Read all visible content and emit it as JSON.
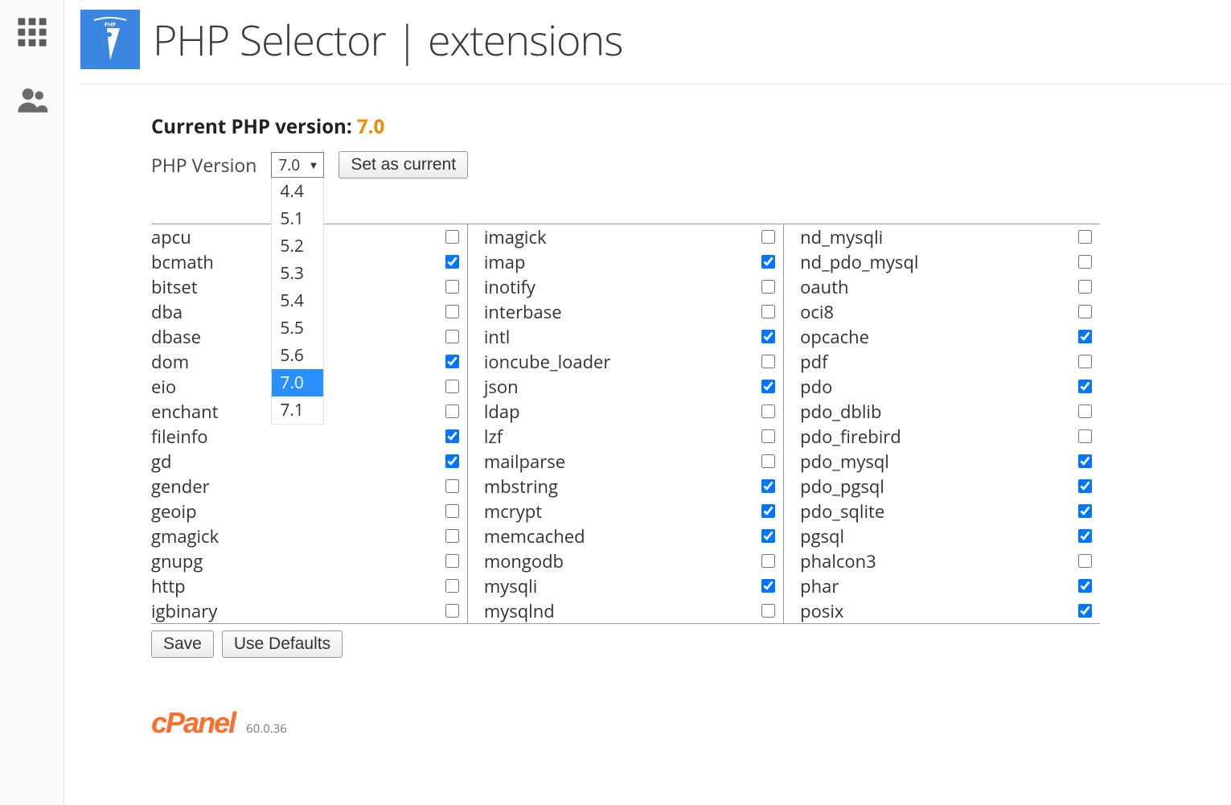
{
  "page_title": "PHP Selector | extensions",
  "current_version_label": "Current PHP version:",
  "current_version_value": "7.0",
  "version_row": {
    "label": "PHP Version",
    "selected": "7.0",
    "set_button": "Set as current",
    "options": [
      "4.4",
      "5.1",
      "5.2",
      "5.3",
      "5.4",
      "5.5",
      "5.6",
      "7.0",
      "7.1"
    ]
  },
  "extensions_columns": [
    [
      {
        "name": "apcu",
        "checked": false
      },
      {
        "name": "bcmath",
        "checked": true
      },
      {
        "name": "bitset",
        "checked": false
      },
      {
        "name": "dba",
        "checked": false
      },
      {
        "name": "dbase",
        "checked": false
      },
      {
        "name": "dom",
        "checked": true
      },
      {
        "name": "eio",
        "checked": false
      },
      {
        "name": "enchant",
        "checked": false
      },
      {
        "name": "fileinfo",
        "checked": true
      },
      {
        "name": "gd",
        "checked": true
      },
      {
        "name": "gender",
        "checked": false
      },
      {
        "name": "geoip",
        "checked": false
      },
      {
        "name": "gmagick",
        "checked": false
      },
      {
        "name": "gnupg",
        "checked": false
      },
      {
        "name": "http",
        "checked": false
      },
      {
        "name": "igbinary",
        "checked": false
      }
    ],
    [
      {
        "name": "imagick",
        "checked": false
      },
      {
        "name": "imap",
        "checked": true
      },
      {
        "name": "inotify",
        "checked": false
      },
      {
        "name": "interbase",
        "checked": false
      },
      {
        "name": "intl",
        "checked": true
      },
      {
        "name": "ioncube_loader",
        "checked": false
      },
      {
        "name": "json",
        "checked": true
      },
      {
        "name": "ldap",
        "checked": false
      },
      {
        "name": "lzf",
        "checked": false
      },
      {
        "name": "mailparse",
        "checked": false
      },
      {
        "name": "mbstring",
        "checked": true
      },
      {
        "name": "mcrypt",
        "checked": true
      },
      {
        "name": "memcached",
        "checked": true
      },
      {
        "name": "mongodb",
        "checked": false
      },
      {
        "name": "mysqli",
        "checked": true
      },
      {
        "name": "mysqlnd",
        "checked": false
      }
    ],
    [
      {
        "name": "nd_mysqli",
        "checked": false
      },
      {
        "name": "nd_pdo_mysql",
        "checked": false
      },
      {
        "name": "oauth",
        "checked": false
      },
      {
        "name": "oci8",
        "checked": false
      },
      {
        "name": "opcache",
        "checked": true
      },
      {
        "name": "pdf",
        "checked": false
      },
      {
        "name": "pdo",
        "checked": true
      },
      {
        "name": "pdo_dblib",
        "checked": false
      },
      {
        "name": "pdo_firebird",
        "checked": false
      },
      {
        "name": "pdo_mysql",
        "checked": true
      },
      {
        "name": "pdo_pgsql",
        "checked": true
      },
      {
        "name": "pdo_sqlite",
        "checked": true
      },
      {
        "name": "pgsql",
        "checked": true
      },
      {
        "name": "phalcon3",
        "checked": false
      },
      {
        "name": "phar",
        "checked": true
      },
      {
        "name": "posix",
        "checked": true
      }
    ]
  ],
  "buttons": {
    "save": "Save",
    "use_defaults": "Use Defaults"
  },
  "footer": {
    "brand": "cPanel",
    "version": "60.0.36"
  }
}
